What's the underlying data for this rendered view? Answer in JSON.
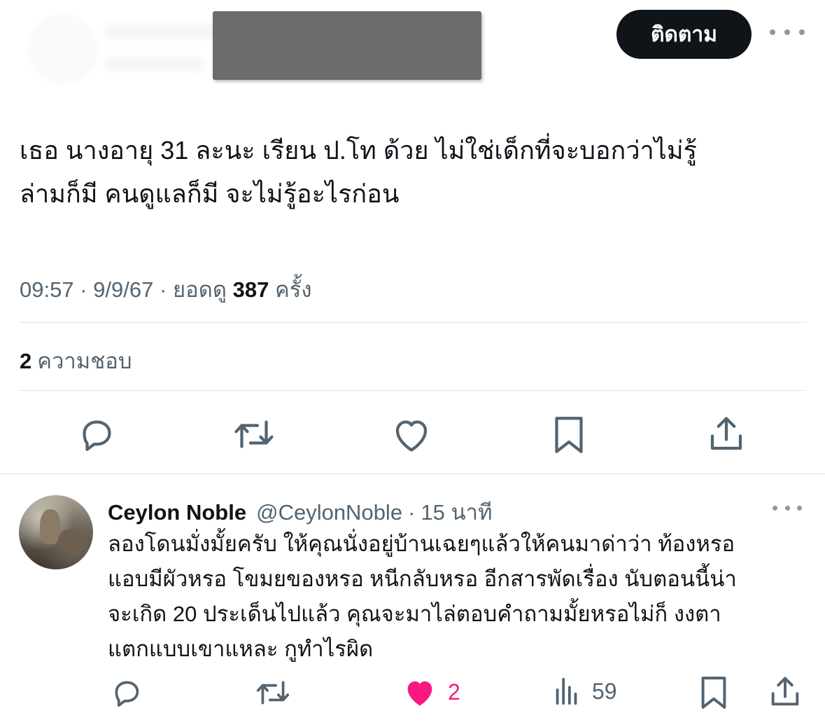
{
  "tweet": {
    "follow_label": "ติดตาม",
    "text_line1": "เธอ นางอายุ 31 ละนะ เรียน ป.โท ด้วย ไม่ใช่เด็กที่จะบอกว่าไม่รู้",
    "text_line2": "ล่ามก็มี คนดูแลก็มี จะไม่รู้อะไรก่อน",
    "time": "09:57",
    "date": "9/9/67",
    "views_label": "ยอดดู",
    "views_count": "387",
    "views_suffix": "ครั้ง",
    "separator": "·",
    "likes_count": "2",
    "likes_label": "ความชอบ"
  },
  "tweet_actions": [
    {
      "name": "reply-icon"
    },
    {
      "name": "retweet-icon"
    },
    {
      "name": "like-icon"
    },
    {
      "name": "bookmark-icon"
    },
    {
      "name": "share-icon"
    }
  ],
  "reply": {
    "name": "Ceylon Noble",
    "handle": "@CeylonNoble",
    "separator": "·",
    "time": "15 นาที",
    "text_line1": "ลองโดนมั่งมั้ยครับ ให้คุณนั่งอยู่บ้านเฉยๆแล้วให้คนมาด่าว่า ท้องหรอ",
    "text_line2": "แอบมีผัวหรอ โขมยของหรอ หนีกลับหรอ อีกสารพัดเรื่อง นับตอนนี้น่า",
    "text_line3": "จะเกิด 20 ประเด็นไปแล้ว คุณจะมาไล่ตอบคำถามมั้ยหรอไม่ก็ งงตา",
    "text_line4": "แตกแบบเขาแหละ กูทำไรผิด",
    "like_count": "2",
    "views_count": "59"
  },
  "colors": {
    "text": "#0f1419",
    "secondary": "#536471",
    "icon": "#536471",
    "liked": "#f91880",
    "divider": "#e1e5e8"
  }
}
